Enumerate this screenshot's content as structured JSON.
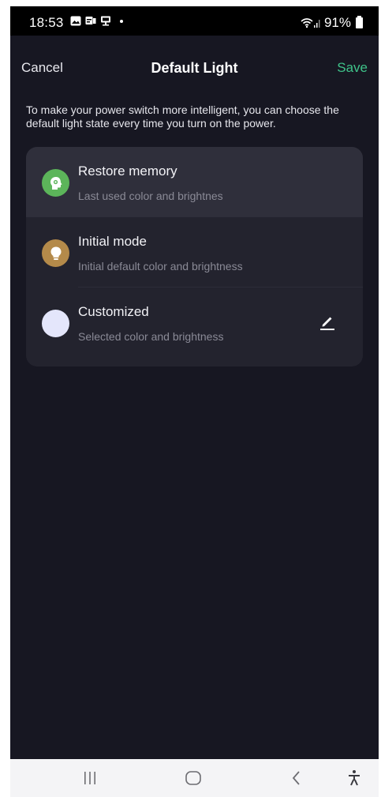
{
  "status_bar": {
    "time": "18:53",
    "battery": "91%"
  },
  "header": {
    "cancel_label": "Cancel",
    "title": "Default Light",
    "save_label": "Save"
  },
  "description": "To make your power switch more intelligent, you can choose the default light state every time you turn on the power.",
  "options": [
    {
      "title": "Restore memory",
      "subtitle": "Last used color and brightnes",
      "icon": "memory-head-icon",
      "icon_color": "#5cb55a",
      "selected": true
    },
    {
      "title": "Initial mode",
      "subtitle": "Initial default color and brightness",
      "icon": "lightbulb-icon",
      "icon_color": "#b48a4a",
      "selected": false
    },
    {
      "title": "Customized",
      "subtitle": "Selected color and brightness",
      "icon": "color-swatch-icon",
      "icon_color": "#e4e6fb",
      "selected": false
    }
  ],
  "colors": {
    "accent": "#3fc38a",
    "background": "#171722",
    "card": "#23232e",
    "selected_row": "#2f2f3b"
  },
  "nav_bar": {
    "recents_icon": "recents-icon",
    "home_icon": "home-icon",
    "back_icon": "back-icon",
    "accessibility_icon": "accessibility-icon"
  }
}
